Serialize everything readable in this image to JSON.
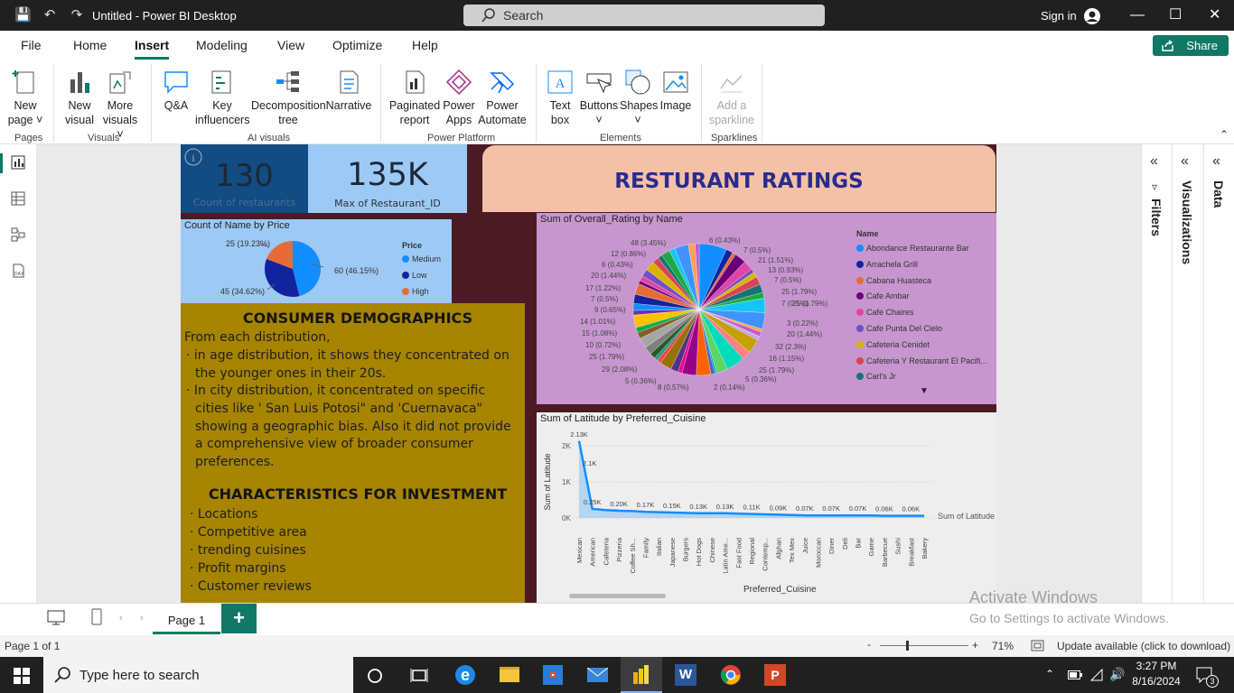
{
  "titlebar": {
    "title": "Untitled - Power BI Desktop",
    "search_label": "Search",
    "sign_in": "Sign in"
  },
  "menu": {
    "items": [
      "File",
      "Home",
      "Insert",
      "Modeling",
      "View",
      "Optimize",
      "Help"
    ],
    "share": "Share"
  },
  "ribbon": {
    "new_page": [
      "New",
      "page"
    ],
    "new_visual": [
      "New",
      "visual"
    ],
    "more_visuals": [
      "More",
      "visuals"
    ],
    "qa": "Q&A",
    "key_influencers": [
      "Key",
      "influencers"
    ],
    "decomp": [
      "Decomposition",
      "tree"
    ],
    "narrative": "Narrative",
    "paginated": [
      "Paginated",
      "report"
    ],
    "power_apps": [
      "Power",
      "Apps"
    ],
    "power_automate": [
      "Power",
      "Automate"
    ],
    "text_box": [
      "Text",
      "box"
    ],
    "buttons": "Buttons",
    "shapes": "Shapes",
    "image": "Image",
    "sparkline": [
      "Add a",
      "sparkline"
    ],
    "groups": {
      "pages": "Pages",
      "visuals": "Visuals",
      "ai": "AI visuals",
      "platform": "Power Platform",
      "elements": "Elements",
      "sparklines": "Sparklines"
    }
  },
  "report": {
    "card1": {
      "value": "130",
      "label": "Count of restaurants"
    },
    "card2": {
      "value": "135K",
      "label": "Max of Restaurant_ID"
    },
    "banner": "RESTURANT RATINGS",
    "pie1": {
      "title": "Count of Name by Price",
      "legend_title": "Price",
      "slices": [
        {
          "name": "Medium",
          "value": 60,
          "label": "60 (46.15%)",
          "color": "#118dff"
        },
        {
          "name": "Low",
          "value": 45,
          "label": "45 (34.62%)",
          "color": "#12239e"
        },
        {
          "name": "High",
          "value": 25,
          "label": "25 (19.23%)",
          "color": "#e66c37"
        }
      ]
    },
    "text": {
      "heading1": "CONSUMER  DEMOGRAPHICS",
      "intro": "From each distribution,",
      "bullets1": [
        "in age distribution, it shows they concentrated on the younger ones in their 20s.",
        "In city distribution, it concentrated on specific cities like ' San Luis Potosi\" and 'Cuernavaca\" showing a geographic bias. Also it did not provide a comprehensive view of broader consumer preferences."
      ],
      "heading2": "CHARACTERISTICS  FOR INVESTMENT",
      "bullets2": [
        " Locations",
        "Competitive area",
        "trending  cuisines",
        "Profit margins",
        "Customer reviews"
      ]
    },
    "pie2": {
      "title": "Sum of Overall_Rating by Name",
      "legend_title": "Name",
      "labels_left": [
        "48 (3.45%)",
        "12 (0.86%)",
        "6 (0.43%)",
        "20 (1.44%)",
        "17 (1.22%)",
        "7 (0.5%)",
        "9 (0.65%)",
        "14 (1.01%)",
        "15 (1.08%)",
        "10 (0.72%)",
        "25 (1.79%)",
        "29 (2.08%)",
        "5 (0.36%)",
        "8 (0.57%)"
      ],
      "labels_right": [
        "6 (0.43%)",
        "7 (0.5%)",
        "21 (1.51%)",
        "13 (0.93%)",
        "7 (0.5%)",
        "25 (1.79%)",
        "25 (1.79%)",
        "7 (0.5%)",
        "3 (0.22%)",
        "20 (1.44%)",
        "32 (2.3%)",
        "16 (1.15%)",
        "25 (1.79%)",
        "5 (0.36%)",
        "2 (0.14%)"
      ],
      "legend": [
        {
          "name": "Abondance Restaurante Bar",
          "color": "#118dff"
        },
        {
          "name": "Arrachela Grill",
          "color": "#12239e"
        },
        {
          "name": "Cabana Huasteca",
          "color": "#e66c37"
        },
        {
          "name": "Cafe Ambar",
          "color": "#6b007b"
        },
        {
          "name": "Cafe Chaires",
          "color": "#e044a7"
        },
        {
          "name": "Cafe Punta Del Cielo",
          "color": "#744ec2"
        },
        {
          "name": "Cafeteria Cenidet",
          "color": "#d9b300"
        },
        {
          "name": "Cafeteria Y Restaurant El Pacifi...",
          "color": "#d64550"
        },
        {
          "name": "Carl's Jr",
          "color": "#197278"
        }
      ]
    }
  },
  "chart_data": {
    "type": "area",
    "title": "Sum of Latitude by Preferred_Cuisine",
    "xlabel": "Preferred_Cuisine",
    "ylabel": "Sum of Latitude",
    "legend": "Sum of Latitude",
    "yticks": [
      "0K",
      "1K",
      "2K"
    ],
    "ylim": [
      0,
      2200
    ],
    "categories": [
      "Mexican",
      "American",
      "Cafeteria",
      "Pizzeria",
      "Coffee Sh...",
      "Family",
      "Italian",
      "Japanese",
      "Burgers",
      "Hot Dogs",
      "Chinese",
      "Latin Ame...",
      "Fast Food",
      "Regional",
      "Contemp...",
      "Afghan",
      "Tex Mex",
      "Juice",
      "Moroccan",
      "Diner",
      "Deli",
      "Bar",
      "Game",
      "Barbecue",
      "Sushi",
      "Breakfast",
      "Bakery"
    ],
    "values": [
      2130,
      250,
      220,
      200,
      190,
      170,
      160,
      150,
      140,
      130,
      130,
      130,
      120,
      110,
      100,
      90,
      80,
      70,
      70,
      70,
      70,
      70,
      70,
      60,
      60,
      60,
      60
    ],
    "data_labels": {
      "0": "2.13K",
      "1": "0.25K",
      "3": "0.20K",
      "5": "0.17K",
      "7": "0.15K",
      "9": "0.13K",
      "11": "0.13K",
      "13": "0.11K",
      "15": "0.09K",
      "17": "0.07K",
      "19": "0.07K",
      "21": "0.07K",
      "23": "0.06K",
      "25": "0.06K"
    },
    "extra_label": "2.1K"
  },
  "tabs": {
    "page1": "Page 1"
  },
  "status": {
    "page": "Page 1 of 1",
    "zoom": "71%",
    "update": "Update available (click to download)"
  },
  "watermark": {
    "line1": "Activate Windows",
    "line2": "Go to Settings to activate Windows."
  },
  "taskbar": {
    "search": "Type here to search",
    "time": "3:27 PM",
    "date": "8/16/2024",
    "notif": "3"
  },
  "panes": {
    "filters": "Filters",
    "visualizations": "Visualizations",
    "data": "Data"
  }
}
